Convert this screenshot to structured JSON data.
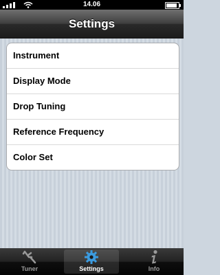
{
  "status_bar": {
    "time": "14.06"
  },
  "nav_bar": {
    "title": "Settings"
  },
  "settings": {
    "items": [
      {
        "label": "Instrument"
      },
      {
        "label": "Display Mode"
      },
      {
        "label": "Drop Tuning"
      },
      {
        "label": "Reference Frequency"
      },
      {
        "label": "Color Set"
      }
    ]
  },
  "tab_bar": {
    "tabs": [
      {
        "label": "Tuner",
        "icon": "tuning-fork-icon"
      },
      {
        "label": "Settings",
        "icon": "gear-icon",
        "selected": true
      },
      {
        "label": "Info",
        "icon": "info-icon"
      }
    ]
  },
  "colors": {
    "accent": "#3b9be0"
  }
}
